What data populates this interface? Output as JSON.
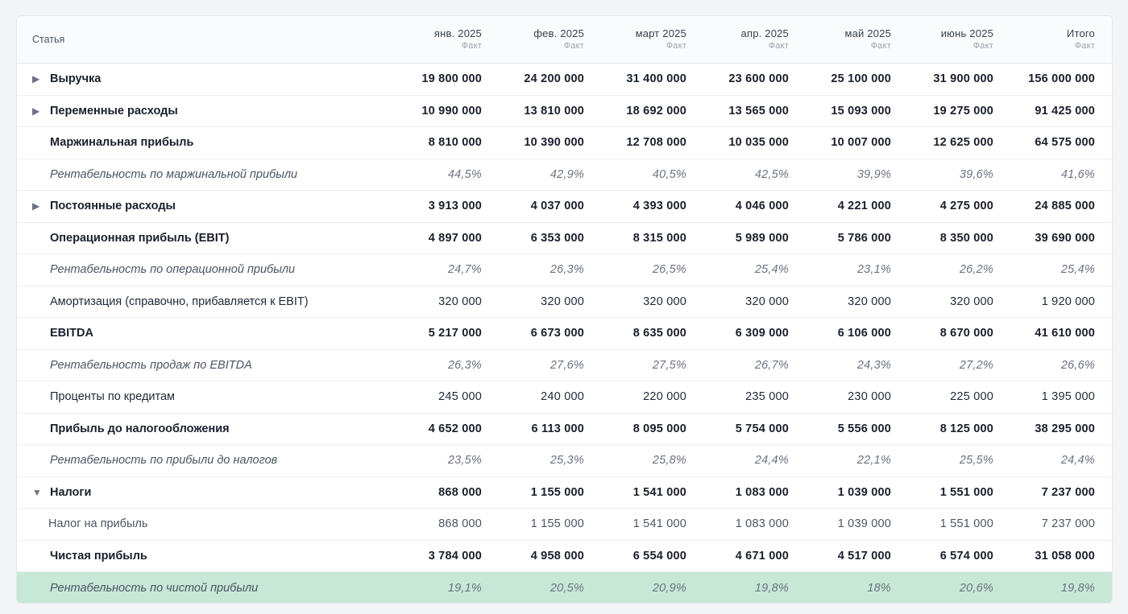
{
  "table": {
    "header": {
      "name_label": "Статья",
      "columns": [
        {
          "month": "янв. 2025",
          "sub": "Факт"
        },
        {
          "month": "фев. 2025",
          "sub": "Факт"
        },
        {
          "month": "март 2025",
          "sub": "Факт"
        },
        {
          "month": "апр. 2025",
          "sub": "Факт"
        },
        {
          "month": "май 2025",
          "sub": "Факт"
        },
        {
          "month": "июнь 2025",
          "sub": "Факт"
        },
        {
          "month": "Итого",
          "sub": "Факт"
        }
      ]
    },
    "rows": [
      {
        "label": "Выручка",
        "style": "bold",
        "toggle": "collapsed",
        "values": [
          "19 800 000",
          "24 200 000",
          "31 400 000",
          "23 600 000",
          "25 100 000",
          "31 900 000",
          "156 000 000"
        ]
      },
      {
        "label": "Переменные расходы",
        "style": "bold",
        "toggle": "collapsed",
        "values": [
          "10 990 000",
          "13 810 000",
          "18 692 000",
          "13 565 000",
          "15 093 000",
          "19 275 000",
          "91 425 000"
        ]
      },
      {
        "label": "Маржинальная прибыль",
        "style": "bold",
        "toggle": "none",
        "values": [
          "8 810 000",
          "10 390 000",
          "12 708 000",
          "10 035 000",
          "10 007 000",
          "12 625 000",
          "64 575 000"
        ]
      },
      {
        "label": "Рентабельность по маржинальной прибыли",
        "style": "italic",
        "toggle": "none",
        "values": [
          "44,5%",
          "42,9%",
          "40,5%",
          "42,5%",
          "39,9%",
          "39,6%",
          "41,6%"
        ]
      },
      {
        "label": "Постоянные расходы",
        "style": "bold",
        "toggle": "collapsed",
        "values": [
          "3 913 000",
          "4 037 000",
          "4 393 000",
          "4 046 000",
          "4 221 000",
          "4 275 000",
          "24 885 000"
        ]
      },
      {
        "label": "Операционная прибыль (EBIT)",
        "style": "bold",
        "toggle": "none",
        "values": [
          "4 897 000",
          "6 353 000",
          "8 315 000",
          "5 989 000",
          "5 786 000",
          "8 350 000",
          "39 690 000"
        ]
      },
      {
        "label": "Рентабельность по операционной прибыли",
        "style": "italic",
        "toggle": "none",
        "values": [
          "24,7%",
          "26,3%",
          "26,5%",
          "25,4%",
          "23,1%",
          "26,2%",
          "25,4%"
        ]
      },
      {
        "label": "Амортизация (справочно, прибавляется к EBIT)",
        "style": "normal",
        "toggle": "none",
        "values": [
          "320 000",
          "320 000",
          "320 000",
          "320 000",
          "320 000",
          "320 000",
          "1 920 000"
        ]
      },
      {
        "label": "EBITDA",
        "style": "bold",
        "toggle": "none",
        "values": [
          "5 217 000",
          "6 673 000",
          "8 635 000",
          "6 309 000",
          "6 106 000",
          "8 670 000",
          "41 610 000"
        ]
      },
      {
        "label": "Рентабельность продаж по EBITDA",
        "style": "italic",
        "toggle": "none",
        "values": [
          "26,3%",
          "27,6%",
          "27,5%",
          "26,7%",
          "24,3%",
          "27,2%",
          "26,6%"
        ]
      },
      {
        "label": "Проценты по кредитам",
        "style": "normal",
        "toggle": "none",
        "values": [
          "245 000",
          "240 000",
          "220 000",
          "235 000",
          "230 000",
          "225 000",
          "1 395 000"
        ]
      },
      {
        "label": "Прибыль до налогообложения",
        "style": "bold",
        "toggle": "none",
        "values": [
          "4 652 000",
          "6 113 000",
          "8 095 000",
          "5 754 000",
          "5 556 000",
          "8 125 000",
          "38 295 000"
        ]
      },
      {
        "label": "Рентабельность по прибыли до налогов",
        "style": "italic",
        "toggle": "none",
        "values": [
          "23,5%",
          "25,3%",
          "25,8%",
          "24,4%",
          "22,1%",
          "25,5%",
          "24,4%"
        ]
      },
      {
        "label": "Налоги",
        "style": "bold",
        "toggle": "expanded",
        "values": [
          "868 000",
          "1 155 000",
          "1 541 000",
          "1 083 000",
          "1 039 000",
          "1 551 000",
          "7 237 000"
        ]
      },
      {
        "label": "Налог на прибыль",
        "style": "child",
        "toggle": "none",
        "values": [
          "868 000",
          "1 155 000",
          "1 541 000",
          "1 083 000",
          "1 039 000",
          "1 551 000",
          "7 237 000"
        ]
      },
      {
        "label": "Чистая прибыль",
        "style": "bold",
        "toggle": "none",
        "values": [
          "3 784 000",
          "4 958 000",
          "6 554 000",
          "4 671 000",
          "4 517 000",
          "6 574 000",
          "31 058 000"
        ]
      },
      {
        "label": "Рентабельность по чистой прибыли",
        "style": "italic highlight",
        "toggle": "none",
        "values": [
          "19,1%",
          "20,5%",
          "20,9%",
          "19,8%",
          "18%",
          "20,6%",
          "19,8%"
        ]
      }
    ]
  },
  "icons": {
    "collapsed": "▶",
    "expanded": "▼"
  },
  "colors": {
    "highlight_row": "#c7e8d7",
    "page_background": "#f3f4f6"
  }
}
